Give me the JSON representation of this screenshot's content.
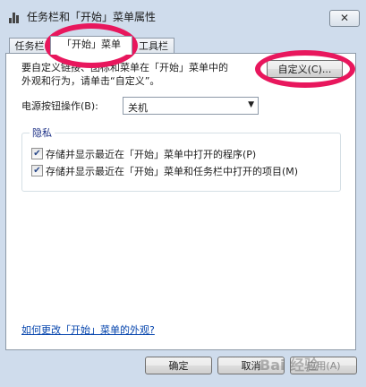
{
  "window": {
    "title": "任务栏和「开始」菜单属性",
    "close_symbol": "✕"
  },
  "tabs": [
    {
      "label": "任务栏"
    },
    {
      "label": "「开始」菜单"
    },
    {
      "label": "工具栏"
    }
  ],
  "start_menu": {
    "description_line1": "要自定义链接、图标和菜单在「开始」菜单中的",
    "description_line2": "外观和行为，请单击“自定义”。",
    "customize_button": "自定义(C)...",
    "power_label": "电源按钮操作(B):",
    "power_select": {
      "value": "关机"
    },
    "privacy": {
      "title": "隐私",
      "options": [
        {
          "label": "存储并显示最近在「开始」菜单中打开的程序(P)",
          "checked": true
        },
        {
          "label": "存储并显示最近在「开始」菜单和任务栏中打开的项目(M)",
          "checked": true
        }
      ]
    },
    "help_link": "如何更改「开始」菜单的外观?"
  },
  "footer": {
    "ok": "确定",
    "cancel": "取消",
    "apply": "应用(A)"
  },
  "watermark": "Bai 经验",
  "annotation_color": "#e8175d"
}
